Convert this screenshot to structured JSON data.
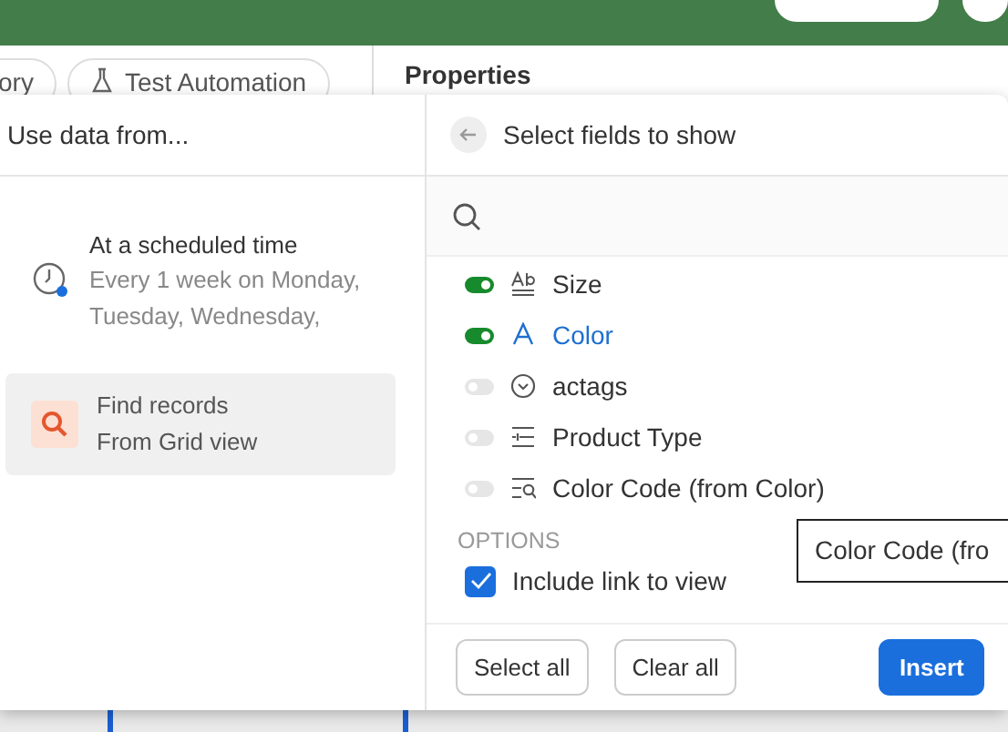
{
  "tabs": [
    {
      "label": "ory",
      "kind": "plain"
    },
    {
      "label": "Test Automation",
      "kind": "flask"
    }
  ],
  "properties_title": "Properties",
  "left_panel": {
    "title": "Use data from...",
    "items": [
      {
        "kind": "schedule",
        "title": "At a scheduled time",
        "subtitle": "Every 1 week on Monday, Tuesday, Wednesday,",
        "selected": false
      },
      {
        "kind": "find",
        "title": "Find records",
        "subtitle": "From Grid view",
        "selected": true
      }
    ]
  },
  "right_panel": {
    "title": "Select fields to show",
    "fields": [
      {
        "name": "Size",
        "kind": "text",
        "on": true,
        "highlighted": false
      },
      {
        "name": "Color",
        "kind": "letter",
        "on": true,
        "highlighted": true
      },
      {
        "name": "actags",
        "kind": "select",
        "on": false,
        "highlighted": false
      },
      {
        "name": "Product Type",
        "kind": "lines",
        "on": false,
        "highlighted": false
      },
      {
        "name": "Color Code (from Color)",
        "kind": "lookup",
        "on": false,
        "highlighted": false
      }
    ],
    "options_label": "OPTIONS",
    "include_link": {
      "label": "Include link to view",
      "checked": true
    },
    "buttons": [
      {
        "label": "Select all",
        "kind": "outline"
      },
      {
        "label": "Clear all",
        "kind": "outline"
      },
      {
        "label": "Insert",
        "kind": "primary"
      }
    ]
  },
  "tooltip": "Color Code (fro"
}
